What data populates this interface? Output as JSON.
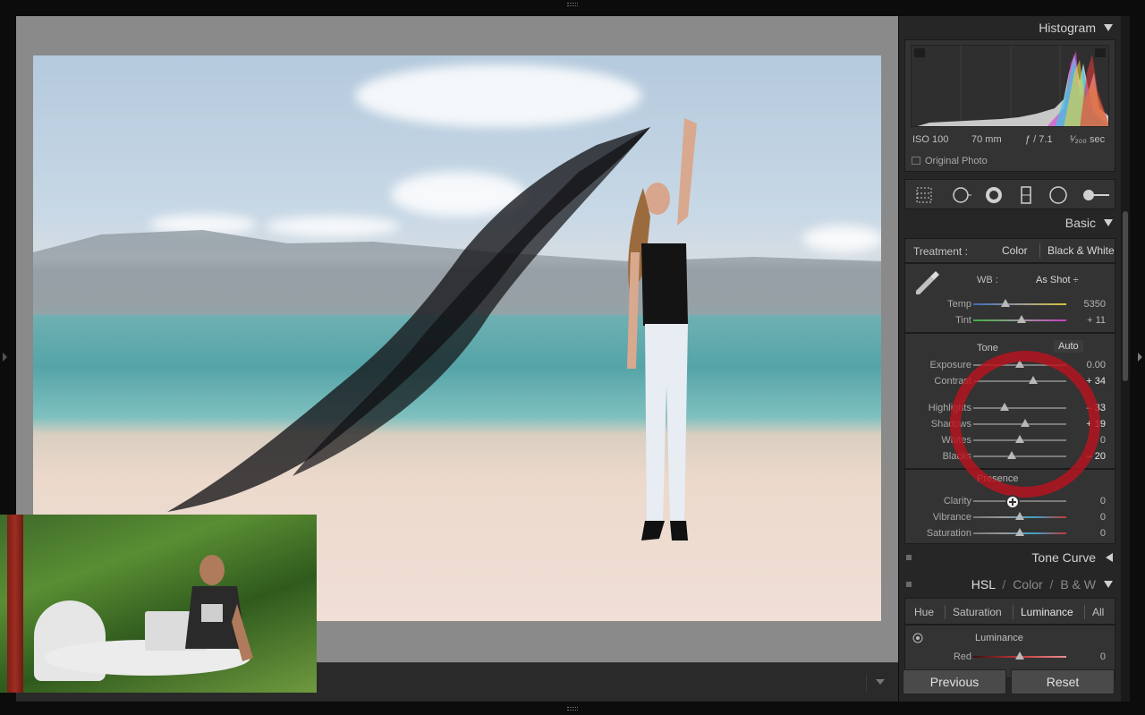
{
  "panel": {
    "histogram": {
      "title": "Histogram",
      "iso": "ISO 100",
      "focal": "70 mm",
      "aperture": "ƒ / 7.1",
      "shutter": "¹⁄₂₀₀ sec",
      "original_photo": "Original Photo"
    },
    "tools": [
      "grid-crop-icon",
      "spot-removal-icon",
      "red-eye-icon",
      "graduated-filter-icon",
      "radial-filter-icon",
      "adjustment-brush-icon"
    ],
    "basic": {
      "title": "Basic",
      "treatment_label": "Treatment :",
      "color": "Color",
      "bw": "Black & White",
      "wb_label": "WB :",
      "wb_value": "As Shot ÷",
      "temp": {
        "name": "Temp",
        "value": "5350",
        "pos": 0.35
      },
      "tint": {
        "name": "Tint",
        "value": "+ 11",
        "pos": 0.52
      },
      "tone_title": "Tone",
      "auto": "Auto",
      "exposure": {
        "name": "Exposure",
        "value": "0.00",
        "pos": 0.5
      },
      "contrast": {
        "name": "Contrast",
        "value": "+ 34",
        "pos": 0.64
      },
      "highlights": {
        "name": "Highlights",
        "value": "– 33",
        "pos": 0.34
      },
      "shadows": {
        "name": "Shadows",
        "value": "+ 19",
        "pos": 0.56
      },
      "whites": {
        "name": "Whites",
        "value": "0",
        "pos": 0.5
      },
      "blacks": {
        "name": "Blacks",
        "value": "– 20",
        "pos": 0.41
      },
      "presence_title": "Presence",
      "clarity": {
        "name": "Clarity",
        "value": "0",
        "pos": 0.42
      },
      "vibrance": {
        "name": "Vibrance",
        "value": "0",
        "pos": 0.5
      },
      "saturation": {
        "name": "Saturation",
        "value": "0",
        "pos": 0.5
      }
    },
    "tone_curve": "Tone Curve",
    "hsl": {
      "hsl": "HSL",
      "slash1": "/",
      "color": "Color",
      "slash2": "/",
      "bw": "B & W",
      "tabs": [
        "Hue",
        "Saturation",
        "Luminance",
        "All"
      ],
      "luminance_title": "Luminance",
      "red": {
        "name": "Red",
        "value": "0",
        "pos": 0.5
      }
    },
    "previous": "Previous",
    "reset": "Reset"
  }
}
